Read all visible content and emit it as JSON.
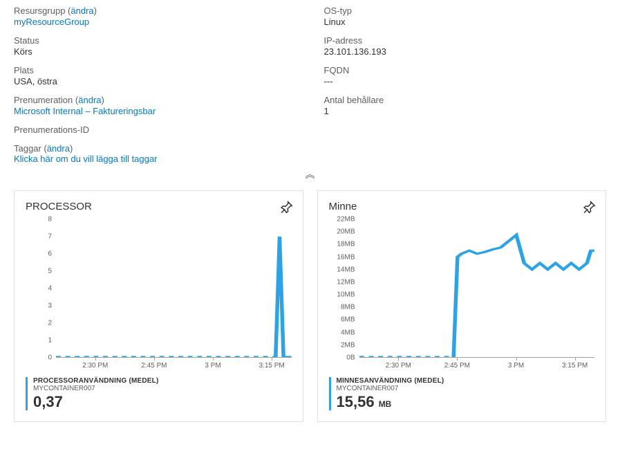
{
  "props": {
    "resourceGroup": {
      "label": "Resursgrupp",
      "changeText": "ändra",
      "value": "myResourceGroup"
    },
    "status": {
      "label": "Status",
      "value": "Körs"
    },
    "location": {
      "label": "Plats",
      "value": "USA, östra"
    },
    "subscription": {
      "label": "Prenumeration",
      "changeText": "ändra",
      "value": "Microsoft Internal – Faktureringsbar"
    },
    "subscriptionId": {
      "label": "Prenumerations-ID",
      "value": ""
    },
    "osType": {
      "label": "OS-typ",
      "value": "Linux"
    },
    "ip": {
      "label": "IP-adress",
      "value": "23.101.136.193"
    },
    "fqdn": {
      "label": "FQDN",
      "value": "---"
    },
    "containers": {
      "label": "Antal behållare",
      "value": "1"
    }
  },
  "tags": {
    "label": "Taggar",
    "changeText": "ändra",
    "addLink": "Klicka här om du vill lägga till taggar"
  },
  "charts": {
    "cpu": {
      "title": "PROCESSOR",
      "legendTitle": "PROCESSORANVÄNDNING (MEDEL)",
      "legendSub": "MYCONTAINER007",
      "legendValue": "0,37",
      "legendUnit": ""
    },
    "mem": {
      "title": "Minne",
      "legendTitle": "MINNESANVÄNDNING (MEDEL)",
      "legendSub": "MYCONTAINER007",
      "legendValue": "15,56",
      "legendUnit": "MB"
    },
    "xticks": [
      "2:30 PM",
      "2:45 PM",
      "3 PM",
      "3:15 PM"
    ]
  },
  "chart_data": [
    {
      "type": "line",
      "title": "PROCESSOR",
      "xlabel": "",
      "ylabel": "",
      "ylim": [
        0,
        8
      ],
      "x_ticks": [
        "2:30 PM",
        "2:45 PM",
        "3 PM",
        "3:15 PM"
      ],
      "series": [
        {
          "name": "Processoranvändning (medel) – MYCONTAINER007",
          "x_minutes": [
            140,
            141,
            142,
            143,
            144,
            145,
            146,
            147,
            148,
            149,
            150,
            151,
            152,
            153,
            154,
            155,
            156,
            157,
            158,
            159,
            160,
            161,
            162,
            163,
            164,
            165,
            166,
            167,
            168,
            169,
            170,
            171,
            172,
            173,
            174,
            175,
            176,
            177,
            178,
            179,
            180,
            181,
            182,
            183,
            184,
            185,
            186,
            187,
            188,
            189,
            190,
            191,
            192,
            193,
            194,
            195,
            196,
            197,
            198,
            199,
            200
          ],
          "values": [
            0,
            0,
            0,
            0,
            0,
            0,
            0,
            0,
            0,
            0,
            0,
            0,
            0,
            0,
            0,
            0,
            0,
            0,
            0,
            0,
            0,
            0,
            0,
            0,
            0,
            0,
            0,
            0,
            0,
            0,
            0,
            0,
            0,
            0,
            0,
            0,
            0,
            0,
            0,
            0,
            0,
            0,
            0,
            0,
            0,
            0,
            0,
            0,
            0,
            0,
            0,
            0,
            0,
            0,
            0,
            0,
            0,
            7,
            0,
            0,
            0
          ]
        }
      ]
    },
    {
      "type": "line",
      "title": "Minne",
      "xlabel": "",
      "ylabel": "",
      "ylim": [
        0,
        22
      ],
      "y_ticks": [
        "0B",
        "2MB",
        "4MB",
        "6MB",
        "8MB",
        "10MB",
        "12MB",
        "14MB",
        "16MB",
        "18MB",
        "20MB",
        "22MB"
      ],
      "x_ticks": [
        "2:30 PM",
        "2:45 PM",
        "3 PM",
        "3:15 PM"
      ],
      "series": [
        {
          "name": "Minnesanvändning (medel) – MYCONTAINER007",
          "x_minutes": [
            140,
            145,
            150,
            155,
            160,
            164,
            165,
            166,
            168,
            170,
            172,
            174,
            176,
            178,
            180,
            182,
            184,
            186,
            188,
            190,
            192,
            194,
            196,
            198,
            199,
            200
          ],
          "values": [
            0,
            0,
            0,
            0,
            0,
            0,
            16,
            16.5,
            17,
            16.5,
            16.8,
            17.2,
            17.5,
            18.5,
            19.5,
            15,
            14,
            15,
            14,
            15,
            14,
            15,
            14,
            15,
            17,
            17
          ]
        }
      ]
    }
  ]
}
